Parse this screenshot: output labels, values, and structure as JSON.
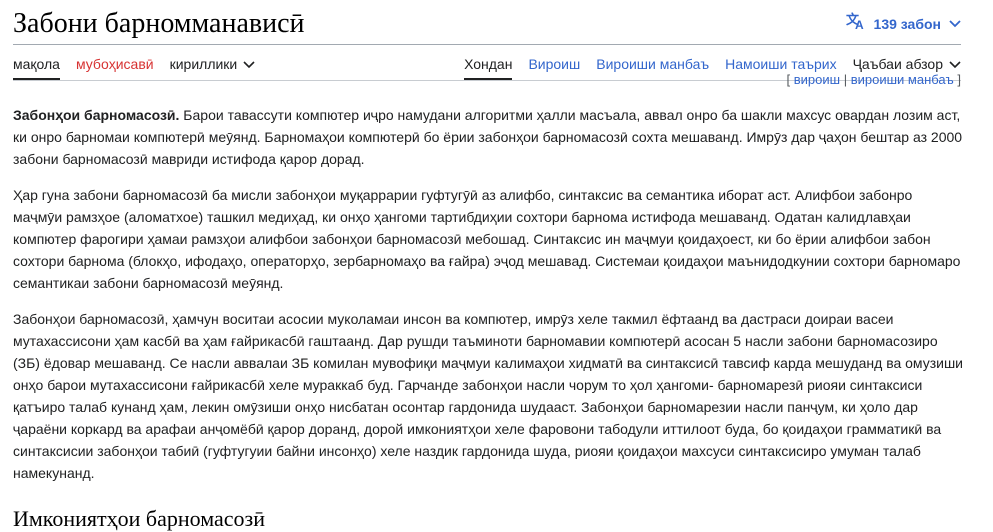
{
  "page": {
    "title": "Забони барномманависӣ"
  },
  "language_button": {
    "label": "139 забон",
    "icon": "translate-icon",
    "chevron": "chevron-down-icon"
  },
  "tabs": {
    "left": [
      {
        "label": "мақола",
        "active": true
      },
      {
        "label": "мубоҳисавӣ",
        "red": true
      },
      {
        "label": "кириллики",
        "dropdown": true
      }
    ],
    "right": [
      {
        "label": "Хондан",
        "active": true
      },
      {
        "label": "Вироиш"
      },
      {
        "label": "Вироиши манбаъ"
      },
      {
        "label": "Намоиши таърих"
      },
      {
        "label": "Ҷаъбаи абзор",
        "dropdown": true
      }
    ]
  },
  "section_edit": {
    "open_bracket": "[",
    "edit": "вироиш",
    "separator": "|",
    "edit_source": "вироиши манбаъ",
    "close_bracket": "]"
  },
  "article": {
    "intro_bold": "Забонҳои барномасозӣ.",
    "paragraph1_rest": " Барои тавассути компютер иҷро намудани алгоритми ҳалли масъала, аввал онро ба шакли махсус овардан лозим аст, ки онро барномаи компютерӣ меӯянд. Барномаҳои компютерӣ бо ёрии забонҳои барномасозӣ сохта мешаванд. Имрӯз дар ҷаҳон бештар аз 2000 забони барномасозӣ мавриди истифода қарор дорад.",
    "paragraph2": "Ҳар гуна забони барномасозӣ ба мисли забонҳои муқаррарии гуфтугӯӣ аз алифбо, синтаксис ва семантика иборат аст. Алифбои забонро маҷмӯи рамзҳое (аломатхое) ташкил медиҳад, ки онҳо ҳангоми тартибдиҳии сохтори барнома истифода мешаванд. Одатан калидлавҳаи компютер фарогири ҳамаи рамзҳои алифбои забонҳои барномасозӣ мебошад. Синтаксис ин маҷмуи қоидаҳоест, ки бо ёрии алифбои забон сохтори барнома (блокҳо, ифодаҳо, операторҳо, зербарномаҳо  ва ғайра) эҷод мешавад. Системаи қоидаҳои маънидодкунии сохтори барномаро семантикаи забони барномасозӣ меӯянд.",
    "paragraph3": "Забонҳои барномасозӣ, ҳамчун воситаи асосии муколамаи инсон ва компютер, имрӯз хеле такмил ёфтаанд ва дастраси доираи васеи мутахассисони ҳам касбӣ ва ҳам ғайрикасбӣ гаштаанд. Дар рушди таъминоти барномавии компютерӣ асосан 5 насли забони барномасозиро (ЗБ) ёдовар мешаванд. Се насли аввалаи ЗБ комилан мувофиқи маҷмуи калимаҳои хидматӣ ва синтаксисӣ тавсиф карда мешуданд ва омузиши онҳо барои мутахассисони ғайрикасбӣ хеле мураккаб буд. Гарчанде забонҳои насли чорум то ҳол ҳангоми- барномарезӣ риояи синтаксиси қатъиро талаб кунанд ҳам, лекин омӯзиши онҳо  нисбатан осонтар гардонида шудааст. Забонҳои барномарезии насли панҷум, ки ҳоло дар ҷараёни коркард ва арафаи анҷомёбӣ қарор доранд, дорой имкониятҳои хеле фаровони табодули иттилоот буда, бо қоидаҳои грамматикӣ ва синтаксисии забонҳои табиӣ (гуфтугуии байни инсонҳо) хеле наздик гардонида шуда, риояи қоидаҳои махсуси синтаксисиро умуман талаб намекунанд.",
    "next_heading": "Имкониятҳои барномасозӣ"
  }
}
